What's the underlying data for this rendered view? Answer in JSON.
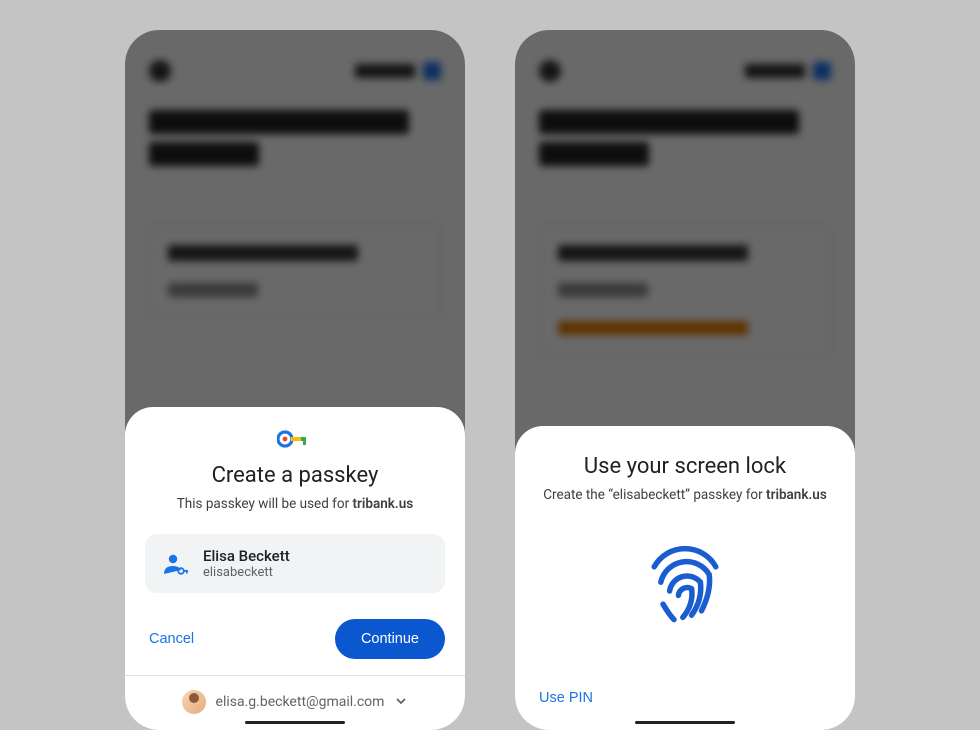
{
  "left": {
    "title": "Create a passkey",
    "subtitle_prefix": "This passkey will be used for ",
    "subtitle_domain": "tribank.us",
    "account": {
      "name": "Elisa Beckett",
      "username": "elisabeckett"
    },
    "cancel_label": "Cancel",
    "continue_label": "Continue",
    "footer_email": "elisa.g.beckett@gmail.com"
  },
  "right": {
    "title": "Use your screen lock",
    "subtitle_prefix": "Create the “",
    "subtitle_username": "elisabeckett",
    "subtitle_middle": "” passkey for ",
    "subtitle_domain": "tribank.us",
    "use_pin_label": "Use PIN"
  }
}
